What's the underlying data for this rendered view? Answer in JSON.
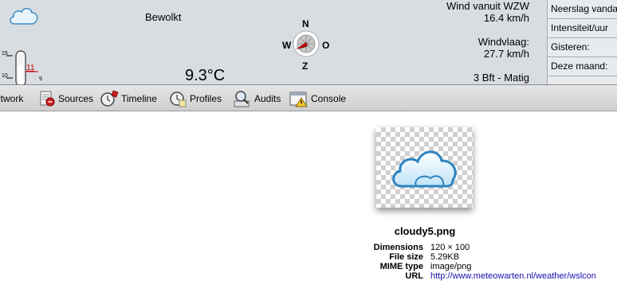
{
  "weather": {
    "condition": "Bewolkt",
    "temperature": "9.3°C",
    "thermometer": {
      "scale_top": "15",
      "scale_bottom": "10",
      "marker": "11",
      "low": "9"
    },
    "compass": {
      "north": "N",
      "west": "W",
      "east": "O",
      "south": "Z"
    },
    "wind_direction": "Wind vanuit WZW",
    "wind_speed": "16.4 km/h",
    "gust_label": "Windvlaag:",
    "gust_speed": "27.7 km/h",
    "beaufort": "3 Bft - Matig",
    "side_rows": [
      "Neerslag vandaag",
      "Intensiteit/uur",
      "Gisteren:",
      "Deze maand:"
    ]
  },
  "toolbar": {
    "items": [
      {
        "label": "etwork",
        "icon": "network-icon"
      },
      {
        "label": "Sources",
        "icon": "sources-icon"
      },
      {
        "label": "Timeline",
        "icon": "timeline-icon"
      },
      {
        "label": "Profiles",
        "icon": "profiles-icon"
      },
      {
        "label": "Audits",
        "icon": "audits-icon"
      },
      {
        "label": "Console",
        "icon": "console-icon"
      }
    ]
  },
  "image": {
    "filename": "cloudy5.png",
    "labels": [
      "Dimensions",
      "File size",
      "MIME type",
      "URL"
    ],
    "dimensions": "120 × 100",
    "file_size": "5.29KB",
    "mime_type": "image/png",
    "url": "http://www.meteowarten.nl/weather/wslcon"
  },
  "colors": {
    "widget_bg": "#d8dde2",
    "toolbar_bg": "#d9d9d9",
    "link": "#1a0dab",
    "marker_red": "#c00000"
  }
}
